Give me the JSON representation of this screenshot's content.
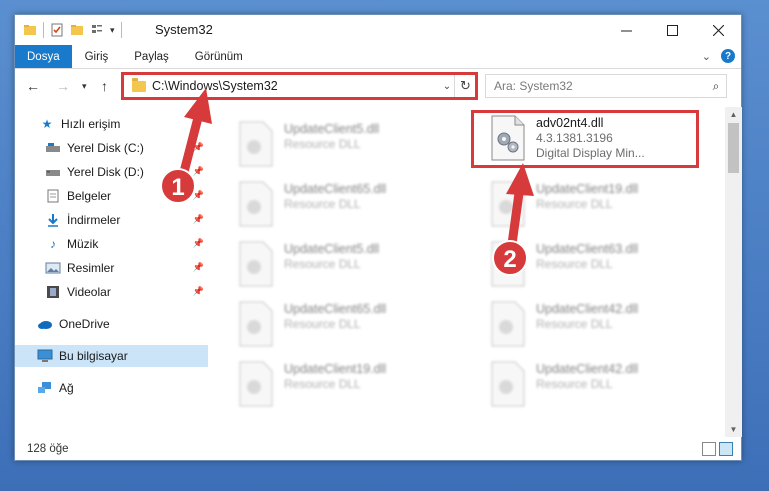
{
  "window": {
    "title": "System32"
  },
  "ribbon": {
    "tabs": [
      {
        "label": "Dosya"
      },
      {
        "label": "Giriş"
      },
      {
        "label": "Paylaş"
      },
      {
        "label": "Görünüm"
      }
    ]
  },
  "address": {
    "path": "C:\\Windows\\System32"
  },
  "search": {
    "placeholder": "Ara: System32"
  },
  "sidebar": {
    "items": [
      {
        "label": "Hızlı erişim",
        "icon": "star-icon"
      },
      {
        "label": "Yerel Disk (C:)",
        "icon": "drive-icon",
        "pinned": true
      },
      {
        "label": "Yerel Disk (D:)",
        "icon": "drive-icon",
        "pinned": true
      },
      {
        "label": "Belgeler",
        "icon": "documents-icon",
        "pinned": true
      },
      {
        "label": "İndirmeler",
        "icon": "download-icon",
        "pinned": true
      },
      {
        "label": "Müzik",
        "icon": "music-icon",
        "pinned": true
      },
      {
        "label": "Resimler",
        "icon": "pictures-icon",
        "pinned": true
      },
      {
        "label": "Videolar",
        "icon": "video-icon",
        "pinned": true
      },
      {
        "label": "OneDrive",
        "icon": "cloud-icon"
      },
      {
        "label": "Bu bilgisayar",
        "icon": "computer-icon",
        "selected": true
      },
      {
        "label": "Ağ",
        "icon": "network-icon"
      }
    ]
  },
  "files": {
    "featured": {
      "name": "adv02nt4.dll",
      "version": "4.3.1381.3196",
      "description": "Digital Display Min..."
    },
    "blurred": [
      {
        "name": "UpdateClient5.dll",
        "type": "Resource DLL"
      },
      {
        "name": "UpdateClient65.dll",
        "type": "Resource DLL"
      },
      {
        "name": "UpdateClient19.dll",
        "type": "Resource DLL"
      },
      {
        "name": "UpdateClient5.dll",
        "type": "Resource DLL"
      },
      {
        "name": "UpdateClient63.dll",
        "type": "Resource DLL"
      },
      {
        "name": "UpdateClient65.dll",
        "type": "Resource DLL"
      },
      {
        "name": "UpdateClient42.dll",
        "type": "Resource DLL"
      },
      {
        "name": "UpdateClient19.dll",
        "type": "Resource DLL"
      },
      {
        "name": "UpdateClient42.dll",
        "type": "Resource DLL"
      }
    ]
  },
  "status": {
    "count": "128 öğe"
  },
  "annotations": {
    "step1": "1",
    "step2": "2"
  },
  "colors": {
    "accent": "#1979ca",
    "highlight": "#d63a3a",
    "selected": "#cce4f7"
  }
}
